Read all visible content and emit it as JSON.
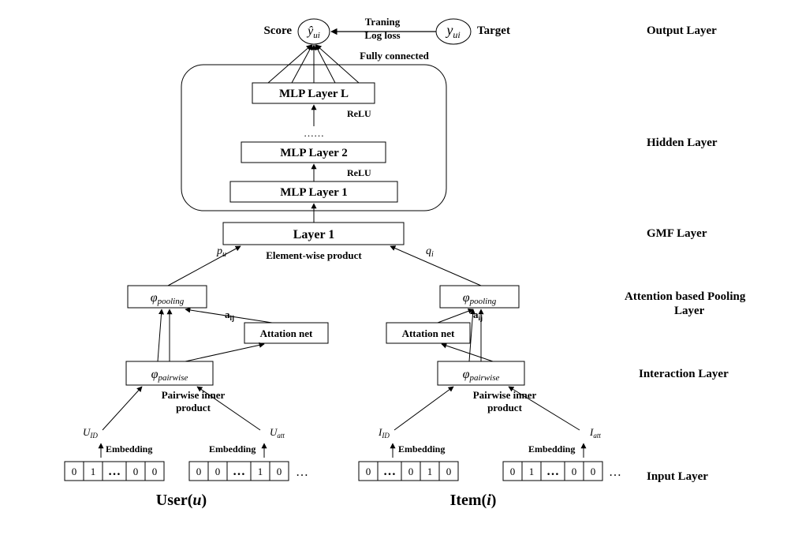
{
  "output": {
    "score": "Score",
    "score_sym": "ŷ",
    "score_sub": "ui",
    "target": "Target",
    "target_sym": "y",
    "target_sub": "ui",
    "arrow1": "Traning",
    "arrow2": "Log loss",
    "fully": "Fully connected",
    "layer_label": "Output Layer"
  },
  "hidden": {
    "layerL": "MLP Layer L",
    "layer2": "MLP Layer 2",
    "layer1": "MLP Layer 1",
    "relu1": "ReLU",
    "relu2": "ReLU",
    "dots": "……",
    "layer_label": "Hidden Layer"
  },
  "gmf": {
    "layer1": "Layer 1",
    "ewp": "Element-wise product",
    "pu": "p",
    "pu_sub": "u",
    "qi": "q",
    "qi_sub": "i",
    "layer_label": "GMF Layer"
  },
  "attention": {
    "pool": "φ",
    "pool_sub": "pooling",
    "aij": "a",
    "aij_sub": "ij",
    "net": "Attation net",
    "layer_label1": "Attention based Pooling",
    "layer_label2": "Layer"
  },
  "interaction": {
    "pair": "φ",
    "pair_sub": "pairwise",
    "pip1": "Pairwise inner",
    "pip2": "product",
    "layer_label": "Interaction Layer"
  },
  "input": {
    "UID": "U",
    "UID_sub": "ID",
    "Uatt": "U",
    "Uatt_sub": "att",
    "IID": "I",
    "IID_sub": "ID",
    "Iatt": "I",
    "Iatt_sub": "att",
    "embed": "Embedding",
    "user": "User(",
    "user_i": "u",
    "user_close": ")",
    "item": "Item(",
    "item_i": "i",
    "item_close": ")",
    "dots": "…",
    "layer_label": "Input Layer",
    "v": {
      "a": "0",
      "b": "1",
      "c": "0",
      "d": "0",
      "e": "0",
      "f": "1",
      "g": "0"
    }
  }
}
